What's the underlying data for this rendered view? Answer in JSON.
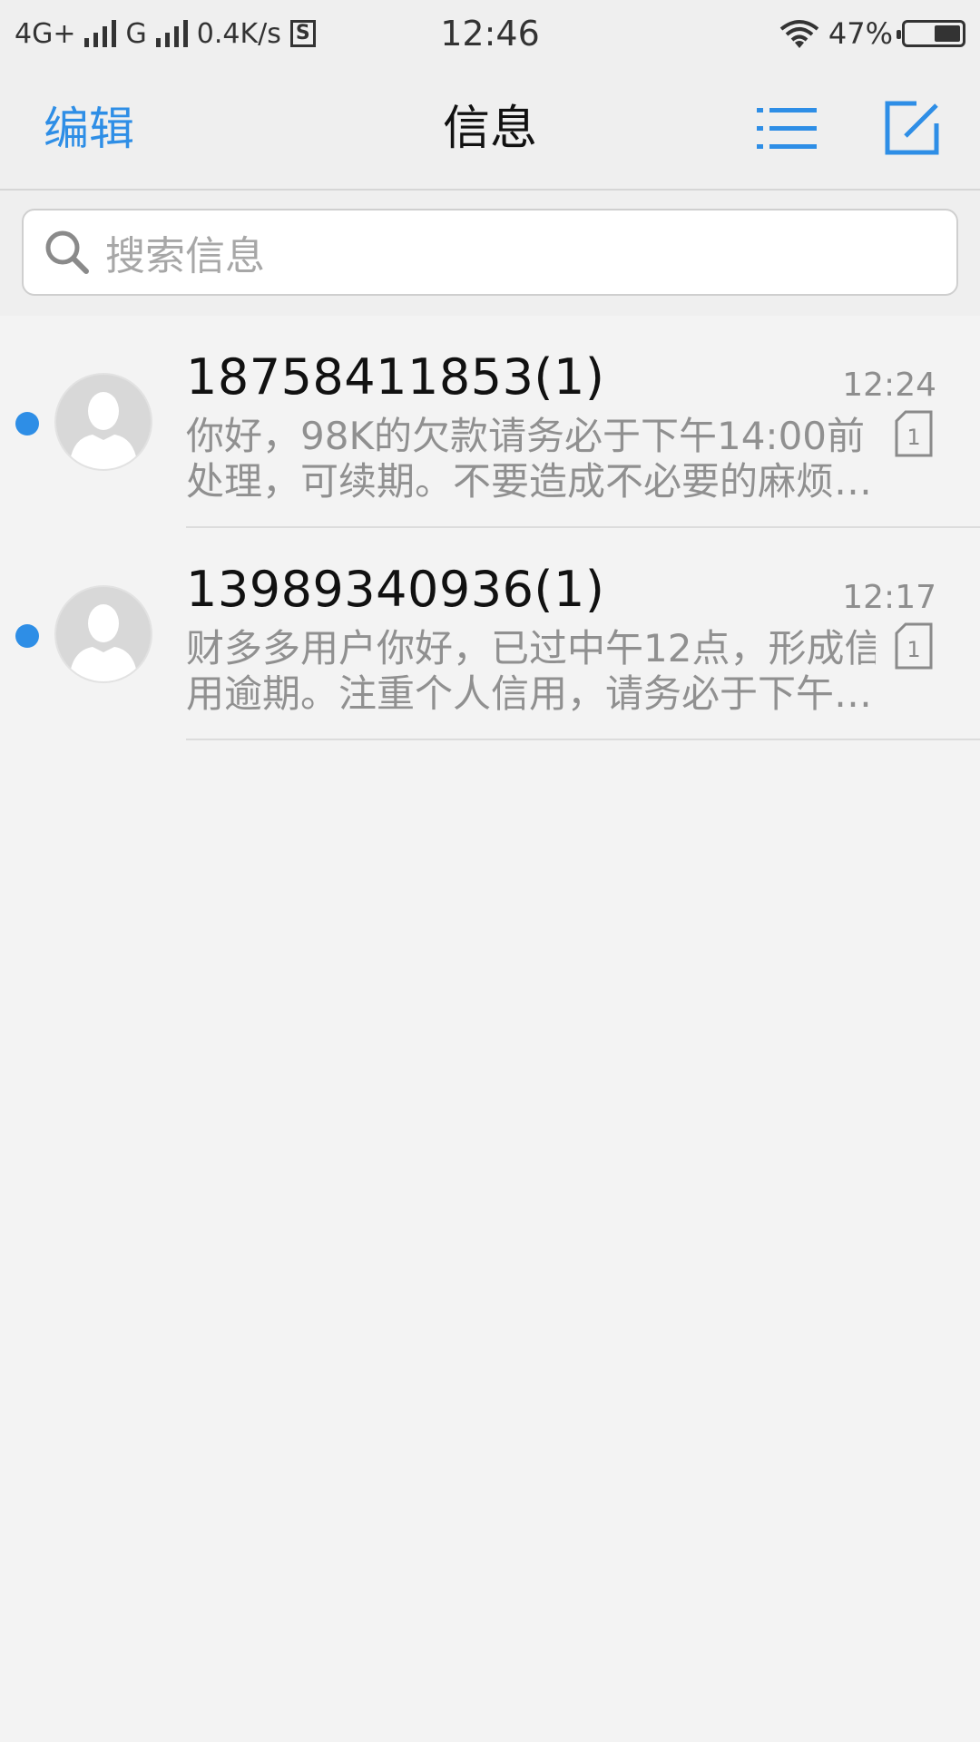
{
  "status_bar": {
    "network1": "4G+",
    "network2": "G",
    "speed": "0.4K/s",
    "s_badge": "S",
    "time": "12:46",
    "battery": "47%",
    "battery_level_percent": 47
  },
  "nav": {
    "edit_label": "编辑",
    "title": "信息"
  },
  "search": {
    "placeholder": "搜索信息"
  },
  "colors": {
    "accent": "#2e8ee6",
    "unread_dot": "#2e8ee6",
    "preview_text": "#909090",
    "background": "#f3f3f3"
  },
  "messages": [
    {
      "sender": "18758411853(1)",
      "time": "12:24",
      "preview_line1": "你好，98K的欠款请务必于下午14:00前",
      "preview_line2": "处理，可续期。不要造成不必要的麻烦…",
      "sim": "1",
      "unread": true
    },
    {
      "sender": "13989340936(1)",
      "time": "12:17",
      "preview_line1": "财多多用户你好，已过中午12点，形成信",
      "preview_line2": "用逾期。注重个人信用，请务必于下午…",
      "sim": "1",
      "unread": true
    }
  ]
}
